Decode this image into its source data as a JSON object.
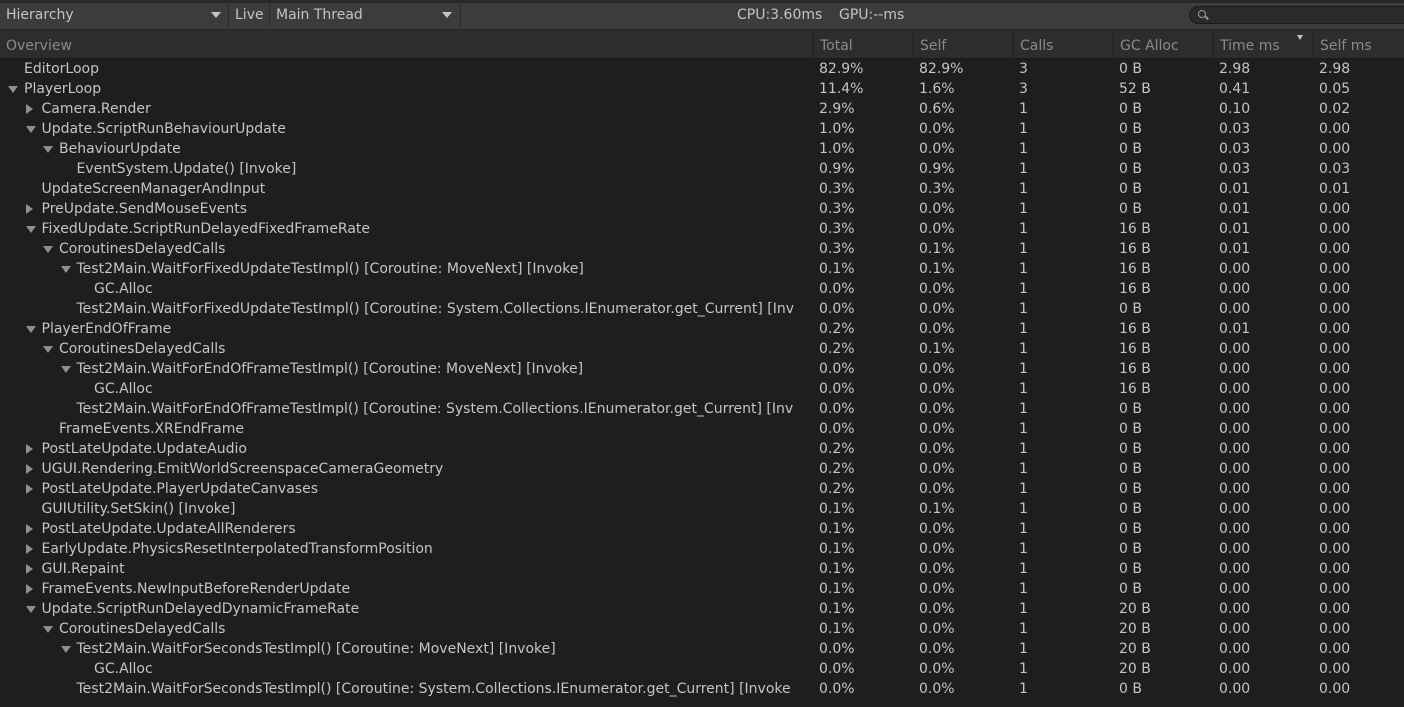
{
  "toolbar": {
    "view_mode": "Hierarchy",
    "live_label": "Live",
    "thread": "Main Thread",
    "cpu": "CPU:3.60ms",
    "gpu": "GPU:--ms",
    "search_placeholder": ""
  },
  "columns": [
    "Overview",
    "Total",
    "Self",
    "Calls",
    "GC Alloc",
    "Time ms",
    "Self ms"
  ],
  "sort_column": "Time ms",
  "rows": [
    {
      "depth": 0,
      "expander": "none",
      "name": "EditorLoop",
      "total": "82.9%",
      "self": "82.9%",
      "calls": "3",
      "gc": "0 B",
      "time": "2.98",
      "selfms": "2.98"
    },
    {
      "depth": 0,
      "expander": "down",
      "name": "PlayerLoop",
      "total": "11.4%",
      "self": "1.6%",
      "calls": "3",
      "gc": "52 B",
      "time": "0.41",
      "selfms": "0.05"
    },
    {
      "depth": 1,
      "expander": "right",
      "name": "Camera.Render",
      "total": "2.9%",
      "self": "0.6%",
      "calls": "1",
      "gc": "0 B",
      "time": "0.10",
      "selfms": "0.02"
    },
    {
      "depth": 1,
      "expander": "down",
      "name": "Update.ScriptRunBehaviourUpdate",
      "total": "1.0%",
      "self": "0.0%",
      "calls": "1",
      "gc": "0 B",
      "time": "0.03",
      "selfms": "0.00"
    },
    {
      "depth": 2,
      "expander": "down",
      "name": "BehaviourUpdate",
      "total": "1.0%",
      "self": "0.0%",
      "calls": "1",
      "gc": "0 B",
      "time": "0.03",
      "selfms": "0.00"
    },
    {
      "depth": 3,
      "expander": "none",
      "name": "EventSystem.Update() [Invoke]",
      "total": "0.9%",
      "self": "0.9%",
      "calls": "1",
      "gc": "0 B",
      "time": "0.03",
      "selfms": "0.03"
    },
    {
      "depth": 1,
      "expander": "none",
      "name": "UpdateScreenManagerAndInput",
      "total": "0.3%",
      "self": "0.3%",
      "calls": "1",
      "gc": "0 B",
      "time": "0.01",
      "selfms": "0.01"
    },
    {
      "depth": 1,
      "expander": "right",
      "name": "PreUpdate.SendMouseEvents",
      "total": "0.3%",
      "self": "0.0%",
      "calls": "1",
      "gc": "0 B",
      "time": "0.01",
      "selfms": "0.00"
    },
    {
      "depth": 1,
      "expander": "down",
      "name": "FixedUpdate.ScriptRunDelayedFixedFrameRate",
      "total": "0.3%",
      "self": "0.0%",
      "calls": "1",
      "gc": "16 B",
      "time": "0.01",
      "selfms": "0.00"
    },
    {
      "depth": 2,
      "expander": "down",
      "name": "CoroutinesDelayedCalls",
      "total": "0.3%",
      "self": "0.1%",
      "calls": "1",
      "gc": "16 B",
      "time": "0.01",
      "selfms": "0.00"
    },
    {
      "depth": 3,
      "expander": "down",
      "name": "Test2Main.WaitForFixedUpdateTestImpl() [Coroutine: MoveNext] [Invoke]",
      "total": "0.1%",
      "self": "0.1%",
      "calls": "1",
      "gc": "16 B",
      "time": "0.00",
      "selfms": "0.00"
    },
    {
      "depth": 4,
      "expander": "none",
      "name": "GC.Alloc",
      "total": "0.0%",
      "self": "0.0%",
      "calls": "1",
      "gc": "16 B",
      "time": "0.00",
      "selfms": "0.00"
    },
    {
      "depth": 3,
      "expander": "none",
      "name": "Test2Main.WaitForFixedUpdateTestImpl() [Coroutine: System.Collections.IEnumerator.get_Current] [Inv",
      "total": "0.0%",
      "self": "0.0%",
      "calls": "1",
      "gc": "0 B",
      "time": "0.00",
      "selfms": "0.00"
    },
    {
      "depth": 1,
      "expander": "down",
      "name": "PlayerEndOfFrame",
      "total": "0.2%",
      "self": "0.0%",
      "calls": "1",
      "gc": "16 B",
      "time": "0.01",
      "selfms": "0.00"
    },
    {
      "depth": 2,
      "expander": "down",
      "name": "CoroutinesDelayedCalls",
      "total": "0.2%",
      "self": "0.1%",
      "calls": "1",
      "gc": "16 B",
      "time": "0.00",
      "selfms": "0.00"
    },
    {
      "depth": 3,
      "expander": "down",
      "name": "Test2Main.WaitForEndOfFrameTestImpl() [Coroutine: MoveNext] [Invoke]",
      "total": "0.0%",
      "self": "0.0%",
      "calls": "1",
      "gc": "16 B",
      "time": "0.00",
      "selfms": "0.00"
    },
    {
      "depth": 4,
      "expander": "none",
      "name": "GC.Alloc",
      "total": "0.0%",
      "self": "0.0%",
      "calls": "1",
      "gc": "16 B",
      "time": "0.00",
      "selfms": "0.00"
    },
    {
      "depth": 3,
      "expander": "none",
      "name": "Test2Main.WaitForEndOfFrameTestImpl() [Coroutine: System.Collections.IEnumerator.get_Current] [Inv",
      "total": "0.0%",
      "self": "0.0%",
      "calls": "1",
      "gc": "0 B",
      "time": "0.00",
      "selfms": "0.00"
    },
    {
      "depth": 2,
      "expander": "none",
      "name": "FrameEvents.XREndFrame",
      "total": "0.0%",
      "self": "0.0%",
      "calls": "1",
      "gc": "0 B",
      "time": "0.00",
      "selfms": "0.00"
    },
    {
      "depth": 1,
      "expander": "right",
      "name": "PostLateUpdate.UpdateAudio",
      "total": "0.2%",
      "self": "0.0%",
      "calls": "1",
      "gc": "0 B",
      "time": "0.00",
      "selfms": "0.00"
    },
    {
      "depth": 1,
      "expander": "right",
      "name": "UGUI.Rendering.EmitWorldScreenspaceCameraGeometry",
      "total": "0.2%",
      "self": "0.0%",
      "calls": "1",
      "gc": "0 B",
      "time": "0.00",
      "selfms": "0.00"
    },
    {
      "depth": 1,
      "expander": "right",
      "name": "PostLateUpdate.PlayerUpdateCanvases",
      "total": "0.2%",
      "self": "0.0%",
      "calls": "1",
      "gc": "0 B",
      "time": "0.00",
      "selfms": "0.00"
    },
    {
      "depth": 1,
      "expander": "none",
      "name": "GUIUtility.SetSkin() [Invoke]",
      "total": "0.1%",
      "self": "0.1%",
      "calls": "1",
      "gc": "0 B",
      "time": "0.00",
      "selfms": "0.00"
    },
    {
      "depth": 1,
      "expander": "right",
      "name": "PostLateUpdate.UpdateAllRenderers",
      "total": "0.1%",
      "self": "0.0%",
      "calls": "1",
      "gc": "0 B",
      "time": "0.00",
      "selfms": "0.00"
    },
    {
      "depth": 1,
      "expander": "right",
      "name": "EarlyUpdate.PhysicsResetInterpolatedTransformPosition",
      "total": "0.1%",
      "self": "0.0%",
      "calls": "1",
      "gc": "0 B",
      "time": "0.00",
      "selfms": "0.00"
    },
    {
      "depth": 1,
      "expander": "right",
      "name": "GUI.Repaint",
      "total": "0.1%",
      "self": "0.0%",
      "calls": "1",
      "gc": "0 B",
      "time": "0.00",
      "selfms": "0.00"
    },
    {
      "depth": 1,
      "expander": "right",
      "name": "FrameEvents.NewInputBeforeRenderUpdate",
      "total": "0.1%",
      "self": "0.0%",
      "calls": "1",
      "gc": "0 B",
      "time": "0.00",
      "selfms": "0.00"
    },
    {
      "depth": 1,
      "expander": "down",
      "name": "Update.ScriptRunDelayedDynamicFrameRate",
      "total": "0.1%",
      "self": "0.0%",
      "calls": "1",
      "gc": "20 B",
      "time": "0.00",
      "selfms": "0.00"
    },
    {
      "depth": 2,
      "expander": "down",
      "name": "CoroutinesDelayedCalls",
      "total": "0.1%",
      "self": "0.0%",
      "calls": "1",
      "gc": "20 B",
      "time": "0.00",
      "selfms": "0.00"
    },
    {
      "depth": 3,
      "expander": "down",
      "name": "Test2Main.WaitForSecondsTestImpl() [Coroutine: MoveNext] [Invoke]",
      "total": "0.0%",
      "self": "0.0%",
      "calls": "1",
      "gc": "20 B",
      "time": "0.00",
      "selfms": "0.00"
    },
    {
      "depth": 4,
      "expander": "none",
      "name": "GC.Alloc",
      "total": "0.0%",
      "self": "0.0%",
      "calls": "1",
      "gc": "20 B",
      "time": "0.00",
      "selfms": "0.00"
    },
    {
      "depth": 3,
      "expander": "none",
      "name": "Test2Main.WaitForSecondsTestImpl() [Coroutine: System.Collections.IEnumerator.get_Current] [Invoke",
      "total": "0.0%",
      "self": "0.0%",
      "calls": "1",
      "gc": "0 B",
      "time": "0.00",
      "selfms": "0.00"
    }
  ]
}
